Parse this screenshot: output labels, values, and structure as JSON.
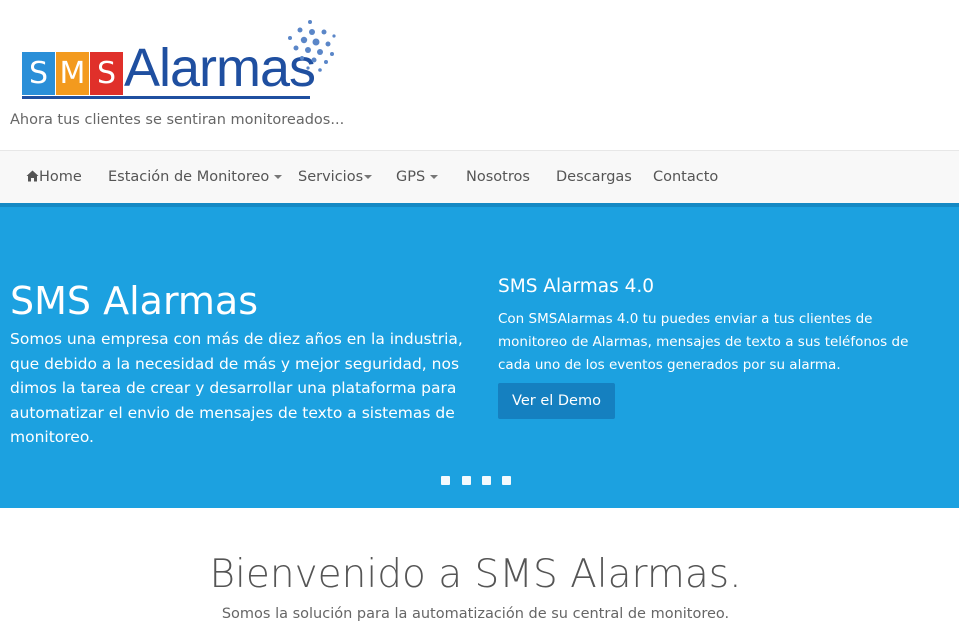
{
  "brand": {
    "logo_letters": [
      "S",
      "M",
      "S"
    ],
    "logo_letter_colors": [
      "#2a8fd8",
      "#f39a1e",
      "#e0302a"
    ],
    "logo_word": "Alarmas",
    "tagline": "Ahora tus clientes se sentiran monitoreados..."
  },
  "nav": {
    "items": [
      {
        "label": "Home",
        "icon": "home-icon",
        "dropdown": false
      },
      {
        "label": "Estación de Monitoreo",
        "dropdown": true
      },
      {
        "label": "Servicios",
        "dropdown": true
      },
      {
        "label": "GPS",
        "dropdown": true
      },
      {
        "label": "Nosotros",
        "dropdown": false
      },
      {
        "label": "Descargas",
        "dropdown": false
      },
      {
        "label": "Contacto",
        "dropdown": false
      }
    ]
  },
  "hero": {
    "title": "SMS Alarmas",
    "text": "Somos una empresa con más de diez años en la industria, que debido a la necesidad de más y mejor seguridad, nos dimos la tarea de crear y desarrollar una plataforma para automatizar el envio de mensajes de texto a sistemas de monitoreo.",
    "sub_title": "SMS Alarmas 4.0",
    "sub_text": "Con SMSAlarmas 4.0 tu puedes enviar a tus clientes de monitoreo de Alarmas, mensajes de texto a sus teléfonos de cada uno de los eventos generados por su alarma.",
    "button_label": "Ver el Demo",
    "slide_count": 4,
    "background_color": "#1ca1e0"
  },
  "welcome": {
    "title": "Bienvenido a SMS Alarmas.",
    "subtitle": "Somos la solución para la automatización de su central de monitoreo."
  }
}
